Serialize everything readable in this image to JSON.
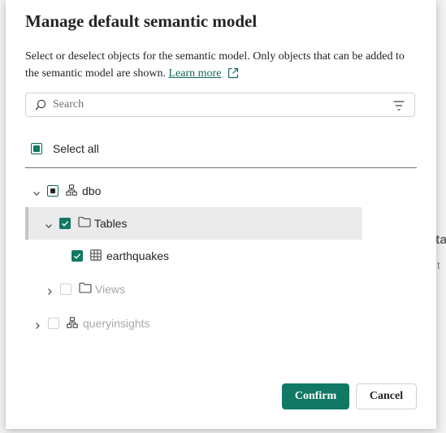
{
  "background": {
    "text1": "ta",
    "text2": "t"
  },
  "dialog": {
    "title": "Manage default semantic model",
    "description": "Select or deselect objects for the semantic model. Only objects that can be added to the semantic model are shown.",
    "learn_more": "Learn more",
    "search": {
      "placeholder": "Search"
    },
    "select_all": {
      "label": "Select all",
      "state": "indeterminate"
    },
    "tree": {
      "dbo": {
        "label": "dbo",
        "state": "indeterminate",
        "icon": "schema-icon",
        "expanded": true
      },
      "tables": {
        "label": "Tables",
        "state": "checked",
        "icon": "folder-icon",
        "expanded": true
      },
      "earthquakes": {
        "label": "earthquakes",
        "state": "checked",
        "icon": "table-icon"
      },
      "views": {
        "label": "Views",
        "state": "unchecked-disabled",
        "icon": "folder-icon",
        "expanded": false
      },
      "queryinsights": {
        "label": "queryinsights",
        "state": "unchecked-disabled",
        "icon": "schema-icon",
        "expanded": false
      }
    },
    "buttons": {
      "confirm": "Confirm",
      "cancel": "Cancel"
    }
  },
  "colors": {
    "accent": "#117865",
    "disabled": "#a8a8a8",
    "selected_row": "#ebebeb"
  }
}
